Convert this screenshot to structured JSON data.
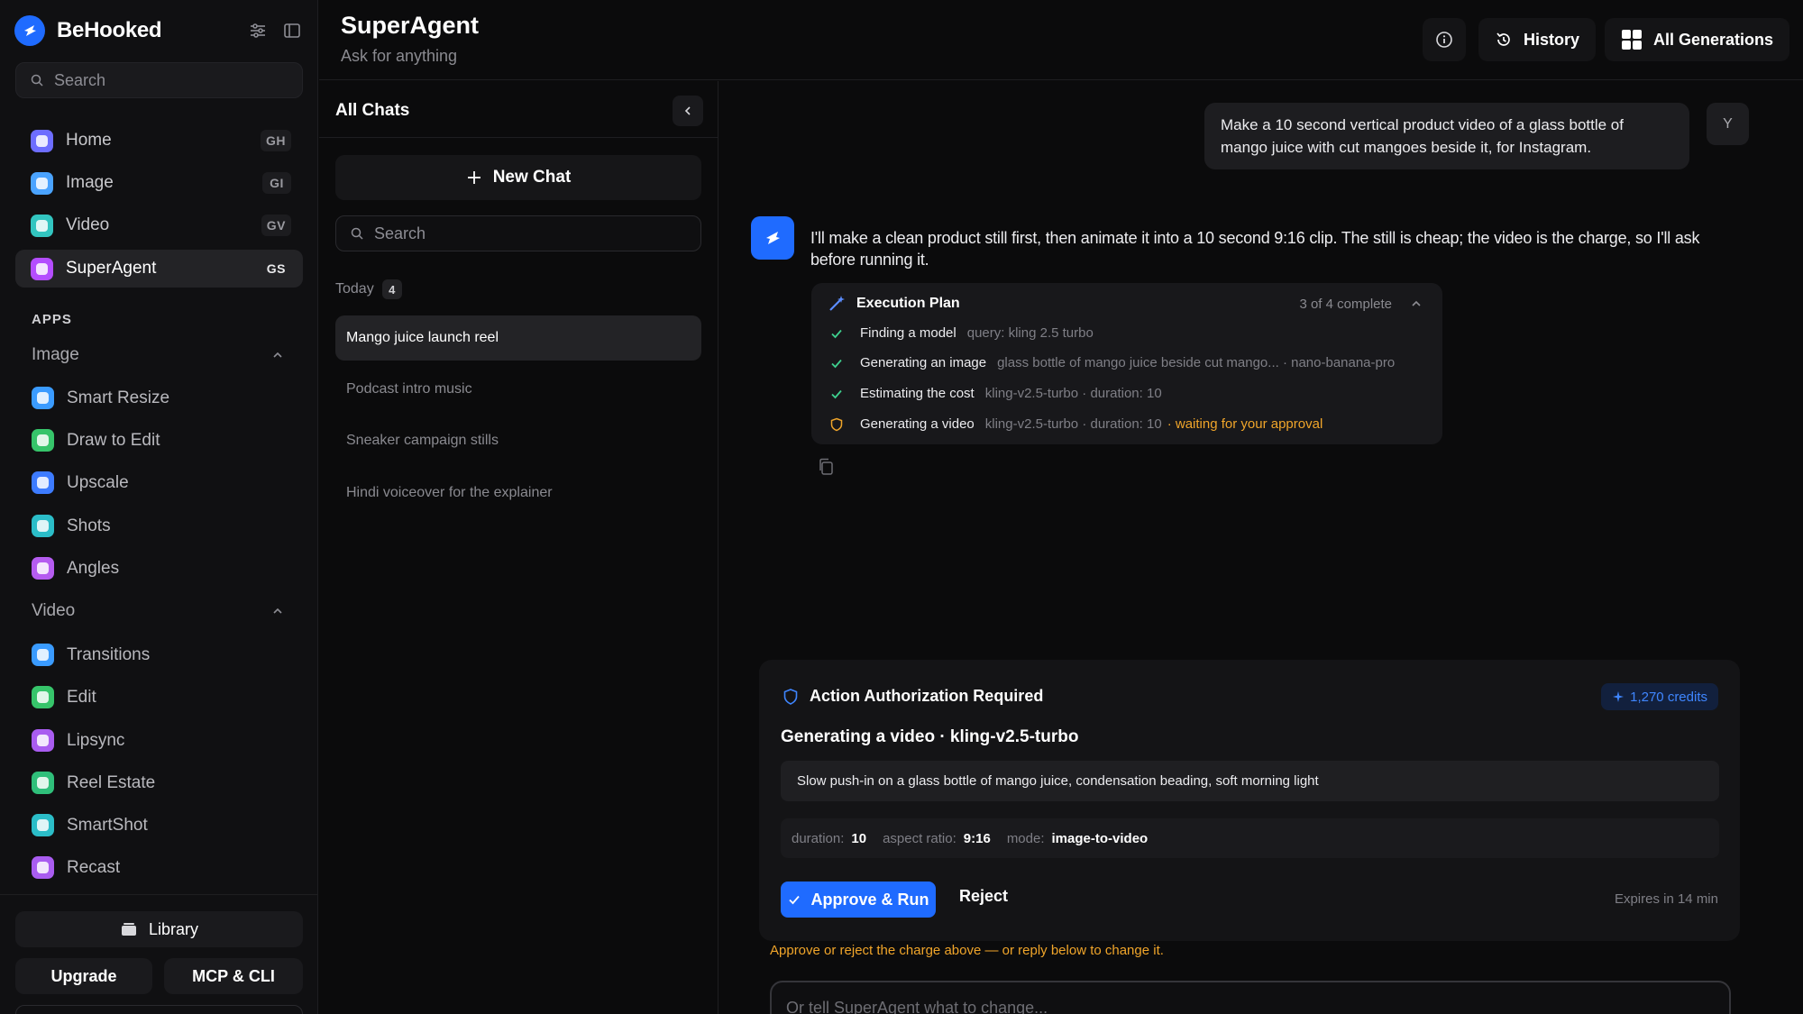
{
  "sidebar": {
    "brand": "BeHooked",
    "search_placeholder": "Search",
    "nav": [
      {
        "label": "Home",
        "shortcut": "GH",
        "color": "#6d6dff"
      },
      {
        "label": "Image",
        "shortcut": "GI",
        "color": "#4aa3ff"
      },
      {
        "label": "Video",
        "shortcut": "GV",
        "color": "#32c5c0"
      },
      {
        "label": "SuperAgent",
        "shortcut": "GS",
        "color": "#b44dff"
      }
    ],
    "apps_label": "APPS",
    "image_group": "Image",
    "image_apps": [
      {
        "label": "Smart Resize",
        "color": "#3a9bff"
      },
      {
        "label": "Draw to Edit",
        "color": "#36c46a"
      },
      {
        "label": "Upscale",
        "color": "#3d7bff"
      },
      {
        "label": "Shots",
        "color": "#2bbdc8"
      },
      {
        "label": "Angles",
        "color": "#b55cf0"
      }
    ],
    "video_group": "Video",
    "video_apps": [
      {
        "label": "Transitions",
        "color": "#3a9bff"
      },
      {
        "label": "Edit",
        "color": "#36c46a"
      },
      {
        "label": "Lipsync",
        "color": "#a95cf0"
      },
      {
        "label": "Reel Estate",
        "color": "#2fbf7a"
      },
      {
        "label": "SmartShot",
        "color": "#2bbdc8"
      },
      {
        "label": "Recast",
        "color": "#a95cf0"
      }
    ],
    "library": "Library",
    "upgrade": "Upgrade",
    "mcp": "MCP & CLI"
  },
  "header": {
    "title": "SuperAgent",
    "subtitle": "Ask for anything",
    "history": "History",
    "all_generations": "All Generations"
  },
  "chats": {
    "title": "All Chats",
    "new_chat": "New Chat",
    "search_placeholder": "Search",
    "today_label": "Today",
    "today_count": "4",
    "items": [
      "Mango juice launch reel",
      "Podcast intro music",
      "Sneaker campaign stills",
      "Hindi voiceover for the explainer"
    ]
  },
  "conversation": {
    "user_message": "Make a 10 second vertical product video of a glass bottle of mango juice with cut mangoes beside it, for Instagram.",
    "user_initial": "Y",
    "agent_message": "I'll make a clean product still first, then animate it into a 10 second 9:16 clip. The still is cheap; the video is the charge, so I'll ask before running it.",
    "plan": {
      "title": "Execution Plan",
      "status": "3 of 4 complete",
      "steps": [
        {
          "name": "Finding a model",
          "detail": "query: kling 2.5 turbo",
          "state": "done",
          "note": ""
        },
        {
          "name": "Generating an image",
          "detail": "glass bottle of mango juice beside cut mango... · nano-banana-pro",
          "state": "done",
          "note": ""
        },
        {
          "name": "Estimating the cost",
          "detail": "kling-v2.5-turbo · duration: 10",
          "state": "done",
          "note": ""
        },
        {
          "name": "Generating a video",
          "detail": "kling-v2.5-turbo · duration: 10",
          "state": "pending",
          "note": "· waiting for your approval"
        }
      ]
    }
  },
  "authorization": {
    "title": "Action Authorization Required",
    "credits": "1,270 credits",
    "subtitle": "Generating a video · kling-v2.5-turbo",
    "prompt": "Slow push-in on a glass bottle of mango juice, condensation beading, soft morning light",
    "params": [
      {
        "key": "duration:",
        "value": "10"
      },
      {
        "key": "aspect ratio:",
        "value": "9:16"
      },
      {
        "key": "mode:",
        "value": "image-to-video"
      }
    ],
    "approve": "Approve & Run",
    "reject": "Reject",
    "expires": "Expires in 14 min",
    "hint": "Approve or reject the charge above — or reply below to change it."
  },
  "reply": {
    "placeholder": "Or tell SuperAgent what to change..."
  },
  "colors": {
    "accent": "#1f6bff",
    "warning": "#f0a52a",
    "done": "#3ecf8e"
  }
}
